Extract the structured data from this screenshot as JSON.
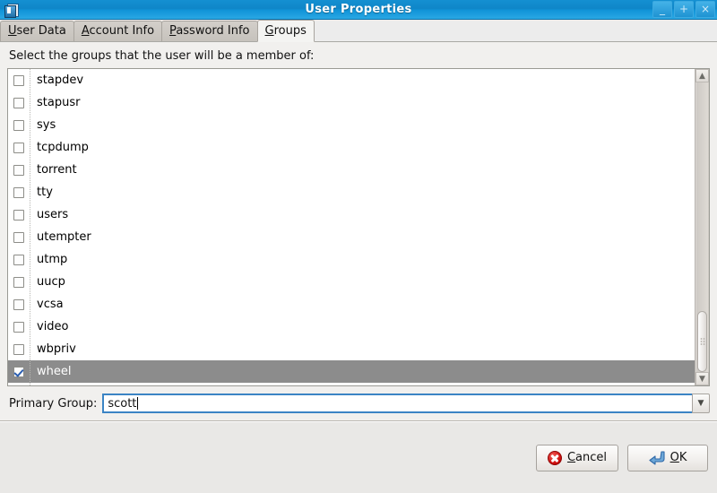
{
  "window": {
    "title": "User Properties",
    "icon": "user-properties-icon",
    "controls": {
      "minimize": "_",
      "maximize": "+",
      "close": "×"
    }
  },
  "tabs": [
    {
      "label": "User Data",
      "mnemonic": "U",
      "active": false
    },
    {
      "label": "Account Info",
      "mnemonic": "A",
      "active": false
    },
    {
      "label": "Password Info",
      "mnemonic": "P",
      "active": false
    },
    {
      "label": "Groups",
      "mnemonic": "G",
      "active": true
    }
  ],
  "main": {
    "instruction": "Select the groups that the user will be a member of:",
    "groups": [
      {
        "name": "stapdev",
        "checked": false,
        "selected": false
      },
      {
        "name": "stapusr",
        "checked": false,
        "selected": false
      },
      {
        "name": "sys",
        "checked": false,
        "selected": false
      },
      {
        "name": "tcpdump",
        "checked": false,
        "selected": false
      },
      {
        "name": "torrent",
        "checked": false,
        "selected": false
      },
      {
        "name": "tty",
        "checked": false,
        "selected": false
      },
      {
        "name": "users",
        "checked": false,
        "selected": false
      },
      {
        "name": "utempter",
        "checked": false,
        "selected": false
      },
      {
        "name": "utmp",
        "checked": false,
        "selected": false
      },
      {
        "name": "uucp",
        "checked": false,
        "selected": false
      },
      {
        "name": "vcsa",
        "checked": false,
        "selected": false
      },
      {
        "name": "video",
        "checked": false,
        "selected": false
      },
      {
        "name": "wbpriv",
        "checked": false,
        "selected": false
      },
      {
        "name": "wheel",
        "checked": true,
        "selected": true
      }
    ],
    "scrollbar": {
      "up_arrow": "▲",
      "down_arrow": "▼",
      "thumb_top_pct": 79,
      "thumb_height_pct": 21
    },
    "primary_group": {
      "label": "Primary Group:",
      "value": "scott",
      "placeholder": "",
      "dropdown_arrow": "▼"
    }
  },
  "buttons": {
    "cancel": {
      "label_pre": "",
      "mnemonic": "C",
      "label_post": "ancel",
      "icon": "cancel-icon"
    },
    "ok": {
      "label_pre": "",
      "mnemonic": "O",
      "label_post": "K",
      "icon": "enter-key-icon"
    }
  },
  "colors": {
    "titlebar": "#1490d2",
    "selection": "#8c8c8c",
    "focus_border": "#3b84c4",
    "cancel_red": "#cc0a0a",
    "ok_blue": "#4a86c8"
  }
}
